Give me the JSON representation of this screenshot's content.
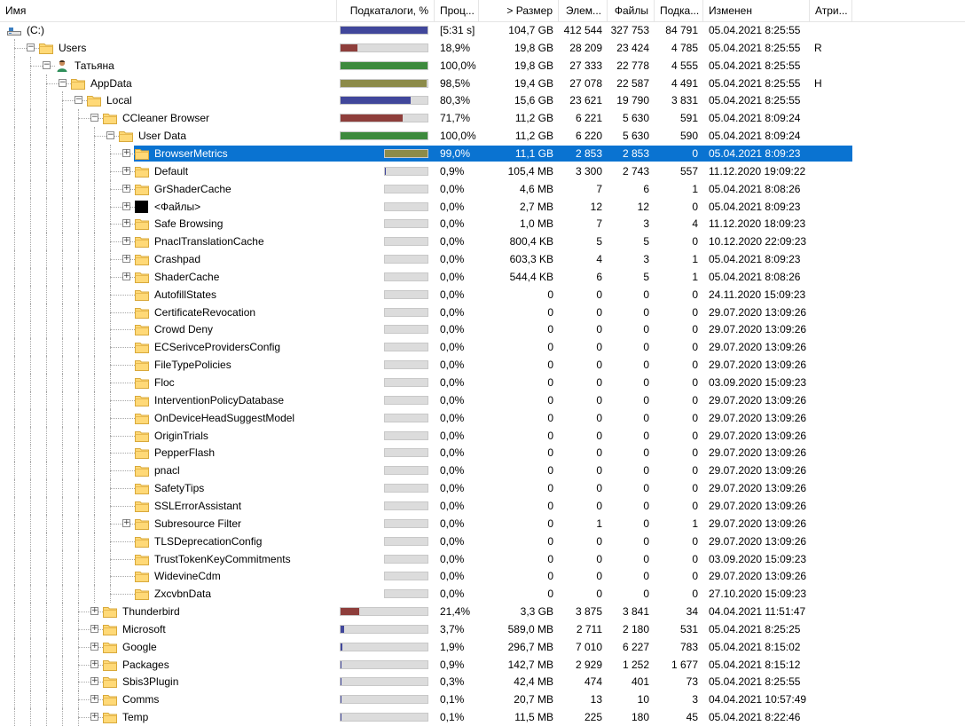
{
  "columns": {
    "name": "Имя",
    "subdirs_pct": "Подкаталоги, %",
    "pct": "Проц...",
    "size": "> Размер",
    "items": "Элем...",
    "files": "Файлы",
    "dirs": "Подка...",
    "modified": "Изменен",
    "attr": "Атри..."
  },
  "colors": {
    "blue": "#41479b",
    "red": "#8e3e3b",
    "green": "#3d8a3d",
    "olive": "#8c8b49",
    "selection": "#0a73d1"
  },
  "rows": [
    {
      "name": "(C:)",
      "icon": "drive-icon",
      "level": 0,
      "exp": "",
      "bar": "big",
      "fill": 1.0,
      "color": "blue",
      "pct": "[5:31 s]",
      "size": "104,7 GB",
      "items": "412 544",
      "files": "327 753",
      "dirs": "84 791",
      "modified": "05.04.2021  8:25:55",
      "attr": ""
    },
    {
      "name": "Users",
      "icon": "folder-icon",
      "level": 1,
      "exp": "−",
      "bar": "big",
      "fill": 0.189,
      "color": "red",
      "pct": "18,9%",
      "size": "19,8 GB",
      "items": "28 209",
      "files": "23 424",
      "dirs": "4 785",
      "modified": "05.04.2021  8:25:55",
      "attr": "R"
    },
    {
      "name": "Татьяна",
      "icon": "user-icon",
      "level": 2,
      "exp": "−",
      "bar": "big",
      "fill": 1.0,
      "color": "green",
      "pct": "100,0%",
      "size": "19,8 GB",
      "items": "27 333",
      "files": "22 778",
      "dirs": "4 555",
      "modified": "05.04.2021  8:25:55",
      "attr": ""
    },
    {
      "name": "AppData",
      "icon": "folder-icon",
      "level": 3,
      "exp": "−",
      "bar": "big",
      "fill": 0.985,
      "color": "olive",
      "pct": "98,5%",
      "size": "19,4 GB",
      "items": "27 078",
      "files": "22 587",
      "dirs": "4 491",
      "modified": "05.04.2021  8:25:55",
      "attr": "H"
    },
    {
      "name": "Local",
      "icon": "folder-icon",
      "level": 4,
      "exp": "−",
      "bar": "big",
      "fill": 0.803,
      "color": "blue",
      "pct": "80,3%",
      "size": "15,6 GB",
      "items": "23 621",
      "files": "19 790",
      "dirs": "3 831",
      "modified": "05.04.2021  8:25:55",
      "attr": ""
    },
    {
      "name": "CCleaner Browser",
      "icon": "folder-icon",
      "level": 5,
      "exp": "−",
      "bar": "big",
      "fill": 0.717,
      "color": "red",
      "pct": "71,7%",
      "size": "11,2 GB",
      "items": "6 221",
      "files": "5 630",
      "dirs": "591",
      "modified": "05.04.2021  8:09:24",
      "attr": ""
    },
    {
      "name": "User Data",
      "icon": "folder-icon",
      "level": 6,
      "exp": "−",
      "bar": "big",
      "fill": 1.0,
      "color": "green",
      "pct": "100,0%",
      "size": "11,2 GB",
      "items": "6 220",
      "files": "5 630",
      "dirs": "590",
      "modified": "05.04.2021  8:09:24",
      "attr": ""
    },
    {
      "name": "BrowserMetrics",
      "icon": "folder-icon",
      "level": 7,
      "exp": "+",
      "bar": "small",
      "fill": 0.99,
      "color": "olive",
      "pct": "99,0%",
      "size": "11,1 GB",
      "items": "2 853",
      "files": "2 853",
      "dirs": "0",
      "modified": "05.04.2021  8:09:23",
      "attr": "",
      "selected": true
    },
    {
      "name": "Default",
      "icon": "folder-icon",
      "level": 7,
      "exp": "+",
      "bar": "small",
      "fill": 0.009,
      "color": "blue",
      "pct": "0,9%",
      "size": "105,4 MB",
      "items": "3 300",
      "files": "2 743",
      "dirs": "557",
      "modified": "11.12.2020  19:09:22",
      "attr": ""
    },
    {
      "name": "GrShaderCache",
      "icon": "folder-icon",
      "level": 7,
      "exp": "+",
      "bar": "small",
      "fill": 0,
      "color": "blue",
      "pct": "0,0%",
      "size": "4,6 MB",
      "items": "7",
      "files": "6",
      "dirs": "1",
      "modified": "05.04.2021  8:08:26",
      "attr": ""
    },
    {
      "name": "<Файлы>",
      "icon": "files-icon",
      "level": 7,
      "exp": "+",
      "bar": "small",
      "fill": 0,
      "color": "blue",
      "pct": "0,0%",
      "size": "2,7 MB",
      "items": "12",
      "files": "12",
      "dirs": "0",
      "modified": "05.04.2021  8:09:23",
      "attr": ""
    },
    {
      "name": "Safe Browsing",
      "icon": "folder-icon",
      "level": 7,
      "exp": "+",
      "bar": "small",
      "fill": 0,
      "color": "blue",
      "pct": "0,0%",
      "size": "1,0 MB",
      "items": "7",
      "files": "3",
      "dirs": "4",
      "modified": "11.12.2020  18:09:23",
      "attr": ""
    },
    {
      "name": "PnaclTranslationCache",
      "icon": "folder-icon",
      "level": 7,
      "exp": "+",
      "bar": "small",
      "fill": 0,
      "color": "blue",
      "pct": "0,0%",
      "size": "800,4 KB",
      "items": "5",
      "files": "5",
      "dirs": "0",
      "modified": "10.12.2020  22:09:23",
      "attr": ""
    },
    {
      "name": "Crashpad",
      "icon": "folder-icon",
      "level": 7,
      "exp": "+",
      "bar": "small",
      "fill": 0,
      "color": "blue",
      "pct": "0,0%",
      "size": "603,3 KB",
      "items": "4",
      "files": "3",
      "dirs": "1",
      "modified": "05.04.2021  8:09:23",
      "attr": ""
    },
    {
      "name": "ShaderCache",
      "icon": "folder-icon",
      "level": 7,
      "exp": "+",
      "bar": "small",
      "fill": 0,
      "color": "blue",
      "pct": "0,0%",
      "size": "544,4 KB",
      "items": "6",
      "files": "5",
      "dirs": "1",
      "modified": "05.04.2021  8:08:26",
      "attr": ""
    },
    {
      "name": "AutofillStates",
      "icon": "folder-icon",
      "level": 7,
      "exp": "",
      "bar": "small",
      "fill": 0,
      "color": "blue",
      "pct": "0,0%",
      "size": "0",
      "items": "0",
      "files": "0",
      "dirs": "0",
      "modified": "24.11.2020  15:09:23",
      "attr": ""
    },
    {
      "name": "CertificateRevocation",
      "icon": "folder-icon",
      "level": 7,
      "exp": "",
      "bar": "small",
      "fill": 0,
      "color": "blue",
      "pct": "0,0%",
      "size": "0",
      "items": "0",
      "files": "0",
      "dirs": "0",
      "modified": "29.07.2020  13:09:26",
      "attr": ""
    },
    {
      "name": "Crowd Deny",
      "icon": "folder-icon",
      "level": 7,
      "exp": "",
      "bar": "small",
      "fill": 0,
      "color": "blue",
      "pct": "0,0%",
      "size": "0",
      "items": "0",
      "files": "0",
      "dirs": "0",
      "modified": "29.07.2020  13:09:26",
      "attr": ""
    },
    {
      "name": "ECSerivceProvidersConfig",
      "icon": "folder-icon",
      "level": 7,
      "exp": "",
      "bar": "small",
      "fill": 0,
      "color": "blue",
      "pct": "0,0%",
      "size": "0",
      "items": "0",
      "files": "0",
      "dirs": "0",
      "modified": "29.07.2020  13:09:26",
      "attr": ""
    },
    {
      "name": "FileTypePolicies",
      "icon": "folder-icon",
      "level": 7,
      "exp": "",
      "bar": "small",
      "fill": 0,
      "color": "blue",
      "pct": "0,0%",
      "size": "0",
      "items": "0",
      "files": "0",
      "dirs": "0",
      "modified": "29.07.2020  13:09:26",
      "attr": ""
    },
    {
      "name": "Floc",
      "icon": "folder-icon",
      "level": 7,
      "exp": "",
      "bar": "small",
      "fill": 0,
      "color": "blue",
      "pct": "0,0%",
      "size": "0",
      "items": "0",
      "files": "0",
      "dirs": "0",
      "modified": "03.09.2020  15:09:23",
      "attr": ""
    },
    {
      "name": "InterventionPolicyDatabase",
      "icon": "folder-icon",
      "level": 7,
      "exp": "",
      "bar": "small",
      "fill": 0,
      "color": "blue",
      "pct": "0,0%",
      "size": "0",
      "items": "0",
      "files": "0",
      "dirs": "0",
      "modified": "29.07.2020  13:09:26",
      "attr": ""
    },
    {
      "name": "OnDeviceHeadSuggestModel",
      "icon": "folder-icon",
      "level": 7,
      "exp": "",
      "bar": "small",
      "fill": 0,
      "color": "blue",
      "pct": "0,0%",
      "size": "0",
      "items": "0",
      "files": "0",
      "dirs": "0",
      "modified": "29.07.2020  13:09:26",
      "attr": ""
    },
    {
      "name": "OriginTrials",
      "icon": "folder-icon",
      "level": 7,
      "exp": "",
      "bar": "small",
      "fill": 0,
      "color": "blue",
      "pct": "0,0%",
      "size": "0",
      "items": "0",
      "files": "0",
      "dirs": "0",
      "modified": "29.07.2020  13:09:26",
      "attr": ""
    },
    {
      "name": "PepperFlash",
      "icon": "folder-icon",
      "level": 7,
      "exp": "",
      "bar": "small",
      "fill": 0,
      "color": "blue",
      "pct": "0,0%",
      "size": "0",
      "items": "0",
      "files": "0",
      "dirs": "0",
      "modified": "29.07.2020  13:09:26",
      "attr": ""
    },
    {
      "name": "pnacl",
      "icon": "folder-icon",
      "level": 7,
      "exp": "",
      "bar": "small",
      "fill": 0,
      "color": "blue",
      "pct": "0,0%",
      "size": "0",
      "items": "0",
      "files": "0",
      "dirs": "0",
      "modified": "29.07.2020  13:09:26",
      "attr": ""
    },
    {
      "name": "SafetyTips",
      "icon": "folder-icon",
      "level": 7,
      "exp": "",
      "bar": "small",
      "fill": 0,
      "color": "blue",
      "pct": "0,0%",
      "size": "0",
      "items": "0",
      "files": "0",
      "dirs": "0",
      "modified": "29.07.2020  13:09:26",
      "attr": ""
    },
    {
      "name": "SSLErrorAssistant",
      "icon": "folder-icon",
      "level": 7,
      "exp": "",
      "bar": "small",
      "fill": 0,
      "color": "blue",
      "pct": "0,0%",
      "size": "0",
      "items": "0",
      "files": "0",
      "dirs": "0",
      "modified": "29.07.2020  13:09:26",
      "attr": ""
    },
    {
      "name": "Subresource Filter",
      "icon": "folder-icon",
      "level": 7,
      "exp": "+",
      "bar": "small",
      "fill": 0,
      "color": "blue",
      "pct": "0,0%",
      "size": "0",
      "items": "1",
      "files": "0",
      "dirs": "1",
      "modified": "29.07.2020  13:09:26",
      "attr": ""
    },
    {
      "name": "TLSDeprecationConfig",
      "icon": "folder-icon",
      "level": 7,
      "exp": "",
      "bar": "small",
      "fill": 0,
      "color": "blue",
      "pct": "0,0%",
      "size": "0",
      "items": "0",
      "files": "0",
      "dirs": "0",
      "modified": "29.07.2020  13:09:26",
      "attr": ""
    },
    {
      "name": "TrustTokenKeyCommitments",
      "icon": "folder-icon",
      "level": 7,
      "exp": "",
      "bar": "small",
      "fill": 0,
      "color": "blue",
      "pct": "0,0%",
      "size": "0",
      "items": "0",
      "files": "0",
      "dirs": "0",
      "modified": "03.09.2020  15:09:23",
      "attr": ""
    },
    {
      "name": "WidevineCdm",
      "icon": "folder-icon",
      "level": 7,
      "exp": "",
      "bar": "small",
      "fill": 0,
      "color": "blue",
      "pct": "0,0%",
      "size": "0",
      "items": "0",
      "files": "0",
      "dirs": "0",
      "modified": "29.07.2020  13:09:26",
      "attr": ""
    },
    {
      "name": "ZxcvbnData",
      "icon": "folder-icon",
      "level": 7,
      "exp": "",
      "bar": "small",
      "fill": 0,
      "color": "blue",
      "pct": "0,0%",
      "size": "0",
      "items": "0",
      "files": "0",
      "dirs": "0",
      "modified": "27.10.2020  15:09:23",
      "attr": ""
    },
    {
      "name": "Thunderbird",
      "icon": "folder-icon",
      "level": 5,
      "exp": "+",
      "bar": "big",
      "fill": 0.214,
      "color": "red",
      "pct": "21,4%",
      "size": "3,3 GB",
      "items": "3 875",
      "files": "3 841",
      "dirs": "34",
      "modified": "04.04.2021  11:51:47",
      "attr": ""
    },
    {
      "name": "Microsoft",
      "icon": "folder-icon",
      "level": 5,
      "exp": "+",
      "bar": "big",
      "fill": 0.037,
      "color": "blue",
      "pct": "3,7%",
      "size": "589,0 MB",
      "items": "2 711",
      "files": "2 180",
      "dirs": "531",
      "modified": "05.04.2021  8:25:25",
      "attr": ""
    },
    {
      "name": "Google",
      "icon": "folder-icon",
      "level": 5,
      "exp": "+",
      "bar": "big",
      "fill": 0.019,
      "color": "blue",
      "pct": "1,9%",
      "size": "296,7 MB",
      "items": "7 010",
      "files": "6 227",
      "dirs": "783",
      "modified": "05.04.2021  8:15:02",
      "attr": ""
    },
    {
      "name": "Packages",
      "icon": "folder-icon",
      "level": 5,
      "exp": "+",
      "bar": "big",
      "fill": 0.009,
      "color": "blue",
      "pct": "0,9%",
      "size": "142,7 MB",
      "items": "2 929",
      "files": "1 252",
      "dirs": "1 677",
      "modified": "05.04.2021  8:15:12",
      "attr": ""
    },
    {
      "name": "Sbis3Plugin",
      "icon": "folder-icon",
      "level": 5,
      "exp": "+",
      "bar": "big",
      "fill": 0.003,
      "color": "blue",
      "pct": "0,3%",
      "size": "42,4 MB",
      "items": "474",
      "files": "401",
      "dirs": "73",
      "modified": "05.04.2021  8:25:55",
      "attr": ""
    },
    {
      "name": "Comms",
      "icon": "folder-icon",
      "level": 5,
      "exp": "+",
      "bar": "big",
      "fill": 0.001,
      "color": "blue",
      "pct": "0,1%",
      "size": "20,7 MB",
      "items": "13",
      "files": "10",
      "dirs": "3",
      "modified": "04.04.2021  10:57:49",
      "attr": ""
    },
    {
      "name": "Temp",
      "icon": "folder-icon",
      "level": 5,
      "exp": "+",
      "bar": "big",
      "fill": 0.001,
      "color": "blue",
      "pct": "0,1%",
      "size": "11,5 MB",
      "items": "225",
      "files": "180",
      "dirs": "45",
      "modified": "05.04.2021  8:22:46",
      "attr": ""
    }
  ]
}
